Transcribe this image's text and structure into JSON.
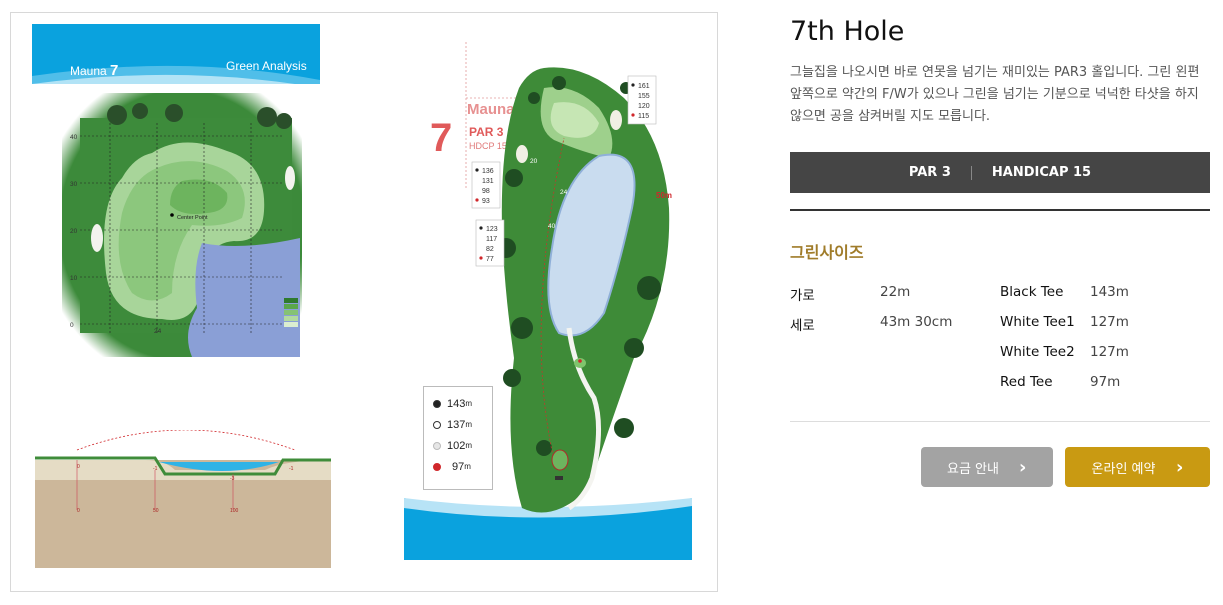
{
  "green_panel": {
    "title_prefix": "Mauna",
    "title_num": "7",
    "subtitle": "Green Analysis",
    "center_label": "Center Point",
    "axis_labels": [
      "40",
      "30",
      "20",
      "10",
      "0"
    ],
    "markers": [
      "24",
      "17",
      "9",
      "26",
      "24"
    ]
  },
  "hole_map": {
    "course": "Mauna",
    "number": "7",
    "par_label": "PAR 3",
    "hdcp_label": "HDCP 15",
    "dist_green_top": [
      "161",
      "155",
      "120",
      "115"
    ],
    "dist_left_1": [
      "136",
      "131",
      "98",
      "93"
    ],
    "dist_left_2": [
      "123",
      "117",
      "82",
      "77"
    ],
    "markers": [
      "20",
      "24",
      "40",
      "50m"
    ],
    "legend": [
      {
        "value": "143",
        "unit": "m",
        "color": "#222222",
        "fill": "filled"
      },
      {
        "value": "137",
        "unit": "m",
        "color": "#ffffff",
        "fill": "outline"
      },
      {
        "value": "102",
        "unit": "m",
        "color": "#dddddd",
        "fill": "light"
      },
      {
        "value": "97",
        "unit": "m",
        "color": "#d0272b",
        "fill": "red"
      }
    ]
  },
  "profile": {
    "labels": [
      "0",
      "-1",
      "-3",
      "-1"
    ],
    "bottom_labels": [
      "0",
      "50",
      "100"
    ]
  },
  "info": {
    "title": "7th Hole",
    "description": "그늘집을 나오시면 바로 연못을 넘기는 재미있는 PAR3 홀입니다. 그린 왼편 앞쪽으로 약간의 F/W가 있으나 그린을 넘기는 기분으로 넉넉한 타샷을 하지 않으면 공을 삼켜버릴 지도 모릅니다.",
    "par": "PAR 3",
    "handicap": "HANDICAP 15",
    "green_size_title": "그린사이즈",
    "green_size": [
      {
        "label": "가로",
        "value": "22m"
      },
      {
        "label": "세로",
        "value": "43m 30cm"
      }
    ],
    "tees": [
      {
        "label": "Black Tee",
        "value": "143m"
      },
      {
        "label": "White Tee1",
        "value": "127m"
      },
      {
        "label": "White Tee2",
        "value": "127m"
      },
      {
        "label": "Red Tee",
        "value": "97m"
      }
    ],
    "btn_fee": "요금 안내",
    "btn_book": "온라인 예약"
  },
  "colors": {
    "accent_gold": "#c99a12",
    "button_gray": "#a3a3a3",
    "par_bar": "#454545",
    "sky_blue": "#0aa2de",
    "grass": "#3f8c3a"
  }
}
